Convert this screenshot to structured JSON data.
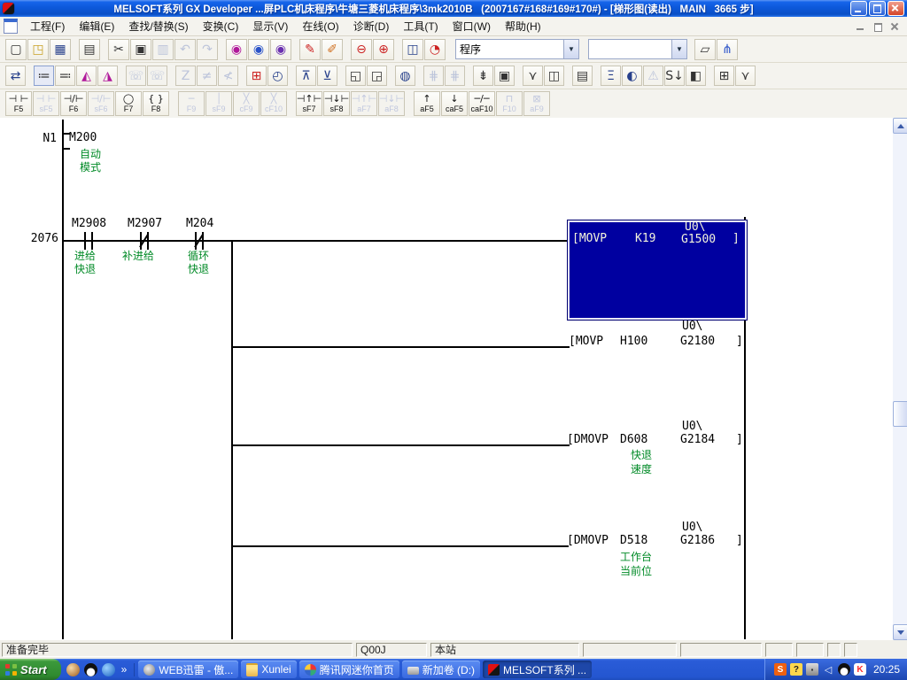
{
  "colors": {
    "titlebar_blue": "#0d58da",
    "selection_blue": "#0000a0",
    "comment_green": "#008a26",
    "taskbar_blue": "#2456d0",
    "start_green": "#2f8a2f"
  },
  "titlebar": {
    "title": "MELSOFT系列 GX Developer ...屏PLC机床程序\\牛塘三菱机床程序\\3mk2010B   (2007167#168#169#170#) - [梯形图(读出)   MAIN   3665 步]"
  },
  "menubar": {
    "items": [
      {
        "n": "menu-project",
        "label": "工程(F)"
      },
      {
        "n": "menu-edit",
        "label": "编辑(E)"
      },
      {
        "n": "menu-find-replace",
        "label": "查找/替换(S)"
      },
      {
        "n": "menu-convert",
        "label": "变换(C)"
      },
      {
        "n": "menu-view",
        "label": "显示(V)"
      },
      {
        "n": "menu-online",
        "label": "在线(O)"
      },
      {
        "n": "menu-diagnostics",
        "label": "诊断(D)"
      },
      {
        "n": "menu-tools",
        "label": "工具(T)"
      },
      {
        "n": "menu-window",
        "label": "窗口(W)"
      },
      {
        "n": "menu-help",
        "label": "帮助(H)"
      }
    ]
  },
  "toolbar_main": {
    "buttons": [
      {
        "n": "new-button",
        "g": "▢"
      },
      {
        "n": "open-button",
        "g": "◳",
        "c": "c-folder"
      },
      {
        "n": "save-button",
        "g": "▦",
        "c": "c-navy"
      },
      {
        "n": "print-button",
        "g": "▤",
        "c": "gap"
      },
      {
        "n": "cut-button",
        "g": "✂",
        "c": "gap"
      },
      {
        "n": "copy-button",
        "g": "▣"
      },
      {
        "n": "paste-button",
        "g": "▥",
        "c": "dis"
      },
      {
        "n": "undo-button",
        "g": "↶",
        "c": "dis"
      },
      {
        "n": "redo-button",
        "g": "↷",
        "c": "dis"
      },
      {
        "n": "find-button",
        "g": "◉",
        "c": "gap c-magenta"
      },
      {
        "n": "find-replace-button",
        "g": "◉",
        "c": "c-blue"
      },
      {
        "n": "device-find-button",
        "g": "◉",
        "c": "c-purple"
      },
      {
        "n": "ladder-write-button",
        "g": "✎",
        "c": "gap c-red"
      },
      {
        "n": "ladder-monitor-write-button",
        "g": "✐",
        "c": "c-orange"
      },
      {
        "n": "zoom-out-button",
        "g": "⊖",
        "c": "gap c-red"
      },
      {
        "n": "zoom-in-button",
        "g": "⊕",
        "c": "c-red"
      },
      {
        "n": "tile-window-button",
        "g": "◫",
        "c": "gap c-navy"
      },
      {
        "n": "project-verify-button",
        "g": "◔",
        "c": "c-red"
      }
    ],
    "program_combo": {
      "value": "程序",
      "arrow": "▼"
    },
    "find_combo": {
      "value": "",
      "arrow": "▼"
    },
    "buttons_right": [
      {
        "n": "doc-create-button",
        "g": "▱",
        "c": "gap"
      },
      {
        "n": "structured-view-button",
        "g": "⋔",
        "c": "c-blue"
      }
    ]
  },
  "toolbar_online": {
    "buttons": [
      {
        "n": "transfer-setup-button",
        "g": "⇄",
        "c": "c-navy"
      },
      {
        "n": "project-data-list-button",
        "g": "≔",
        "c": "gap on"
      },
      {
        "n": "data-edit-button",
        "g": "≕"
      },
      {
        "n": "device-search-button",
        "g": "◭",
        "c": "c-magenta"
      },
      {
        "n": "device-edit-button",
        "g": "◮",
        "c": "c-magenta"
      },
      {
        "n": "remote-operation-button",
        "g": "☏",
        "c": "gap dis"
      },
      {
        "n": "remote-monitor-button",
        "g": "☏",
        "c": "dis"
      },
      {
        "n": "inline-edit-button",
        "g": "Z",
        "c": "gap dis"
      },
      {
        "n": "line-edit-button",
        "g": "≠",
        "c": "dis"
      },
      {
        "n": "line-delete-button",
        "g": "≮",
        "c": "dis"
      },
      {
        "n": "device-memory-button",
        "g": "⊞",
        "c": "gap c-red"
      },
      {
        "n": "clock-setting-button",
        "g": "◴",
        "c": "c-navy"
      },
      {
        "n": "read-from-plc-button",
        "g": "⊼",
        "c": "gap c-navy"
      },
      {
        "n": "write-to-plc-button",
        "g": "⊻",
        "c": "c-navy"
      },
      {
        "n": "window-cascade-button",
        "g": "◱",
        "c": "gap"
      },
      {
        "n": "window-tile-button",
        "g": "◲"
      },
      {
        "n": "monitor-mode-button",
        "g": "◍",
        "c": "gap c-navy"
      },
      {
        "n": "monitor-row-button",
        "g": "⋕",
        "c": "gap dis"
      },
      {
        "n": "monitor-write-button",
        "g": "⋕",
        "c": "dis"
      },
      {
        "n": "step-run-button",
        "g": "⇟",
        "c": "gap"
      },
      {
        "n": "monitor-stop-button",
        "g": "▣"
      },
      {
        "n": "program-branch-button",
        "g": "⋎",
        "c": "gap"
      },
      {
        "n": "program-compare-button",
        "g": "◫"
      },
      {
        "n": "data-list-button",
        "g": "▤",
        "c": "gap"
      },
      {
        "n": "sampling-trace-button",
        "g": "Ξ",
        "c": "gap c-navy"
      },
      {
        "n": "buffer-memory-button",
        "g": "◐",
        "c": "c-navy"
      },
      {
        "n": "error-jump-button",
        "g": "⚠",
        "c": "dis"
      },
      {
        "n": "sfc-step-button",
        "g": "S↓"
      },
      {
        "n": "sfc-block-button",
        "g": "◧"
      },
      {
        "n": "zoom-block-button",
        "g": "⊞",
        "c": "gap"
      },
      {
        "n": "tree-down-button",
        "g": "⋎"
      }
    ]
  },
  "toolbar_ladder": {
    "buttons": [
      {
        "n": "open-contact-button",
        "sym": "⊣ ⊢",
        "key": "F5"
      },
      {
        "n": "open-branch-button",
        "sym": "⊣ ⊢",
        "key": "sF5",
        "c": "dis"
      },
      {
        "n": "closed-contact-button",
        "sym": "⊣/⊢",
        "key": "F6"
      },
      {
        "n": "closed-branch-button",
        "sym": "⊣/⊢",
        "key": "sF6",
        "c": "dis"
      },
      {
        "n": "coil-button",
        "sym": "◯",
        "key": "F7"
      },
      {
        "n": "application-instruction-button",
        "sym": "{ }",
        "key": "F8"
      },
      {
        "n": "horizontal-line-button",
        "sym": "─",
        "key": "F9",
        "c": "gap dis"
      },
      {
        "n": "vertical-line-button",
        "sym": "│",
        "key": "sF9",
        "c": "dis"
      },
      {
        "n": "delete-hline-button",
        "sym": "╳",
        "key": "cF9",
        "c": "dis"
      },
      {
        "n": "delete-vline-button",
        "sym": "╳",
        "key": "cF10",
        "c": "dis"
      },
      {
        "n": "rising-pulse-button",
        "sym": "⊣↑⊢",
        "key": "sF7",
        "c": "gap"
      },
      {
        "n": "falling-pulse-button",
        "sym": "⊣↓⊢",
        "key": "sF8"
      },
      {
        "n": "rising-pulse-branch-button",
        "sym": "⊣↑⊢",
        "key": "aF7",
        "c": "dis"
      },
      {
        "n": "falling-pulse-branch-button",
        "sym": "⊣↓⊢",
        "key": "aF8",
        "c": "dis"
      },
      {
        "n": "rising-edge-button",
        "sym": "↑",
        "key": "aF5",
        "c": "gap"
      },
      {
        "n": "falling-edge-button",
        "sym": "↓",
        "key": "caF5"
      },
      {
        "n": "invert-result-button",
        "sym": "─/─",
        "key": "caF10"
      },
      {
        "n": "edge-relay-button",
        "sym": "⊓",
        "key": "F10",
        "c": "dis"
      },
      {
        "n": "delete-button",
        "sym": "⊠",
        "key": "aF9",
        "c": "dis"
      }
    ]
  },
  "ladder": {
    "nest_label": "N1",
    "nest_device": "M200",
    "nest_comment": [
      "自动",
      "模式"
    ],
    "step_number": "2076",
    "contacts": [
      {
        "device": "M2908",
        "comment": [
          "进给",
          "快退"
        ]
      },
      {
        "device": "M2907",
        "comment": [
          "补进给",
          ""
        ]
      },
      {
        "device": "M204",
        "comment": [
          "循环",
          "快退"
        ]
      }
    ],
    "instructions": [
      {
        "op": "[MOVP",
        "src": "K19",
        "bus": "U0\\",
        "dst": "G1500",
        "rb": "]"
      },
      {
        "op": "[MOVP",
        "src": "H100",
        "bus": "U0\\",
        "dst": "G2180",
        "rb": "]"
      },
      {
        "op": "[DMOVP",
        "src": "D608",
        "bus": "U0\\",
        "dst": "G2184",
        "rb": "]",
        "comment": [
          "快退",
          "速度"
        ]
      },
      {
        "op": "[DMOVP",
        "src": "D518",
        "bus": "U0\\",
        "dst": "G2186",
        "rb": "]",
        "comment": [
          "工作台",
          "当前位"
        ]
      }
    ]
  },
  "statusbar": {
    "ready": "准备完毕",
    "cpu": "Q00J",
    "station": "本站"
  },
  "taskbar": {
    "start_label": "Start",
    "chevron": "»",
    "tasks": [
      {
        "n": "task-web-thunder",
        "label": "WEB迅雷 - 傲...",
        "icn": "ic-m"
      },
      {
        "n": "task-xunlei",
        "label": "Xunlei",
        "icn": "ic-folder"
      },
      {
        "n": "task-tencent-mini",
        "label": "腾讯网迷你首页",
        "icn": "ic-tx"
      },
      {
        "n": "task-volume-d",
        "label": "新加卷 (D:)",
        "icn": "ic-drive"
      },
      {
        "n": "task-melsoft",
        "label": "MELSOFT系列 ...",
        "icn": "ic-mel",
        "cls": "active"
      }
    ],
    "tray": {
      "sogou": "S",
      "help": "?",
      "collapse": "◁",
      "kaspersky": "K",
      "time": "20:25"
    }
  }
}
